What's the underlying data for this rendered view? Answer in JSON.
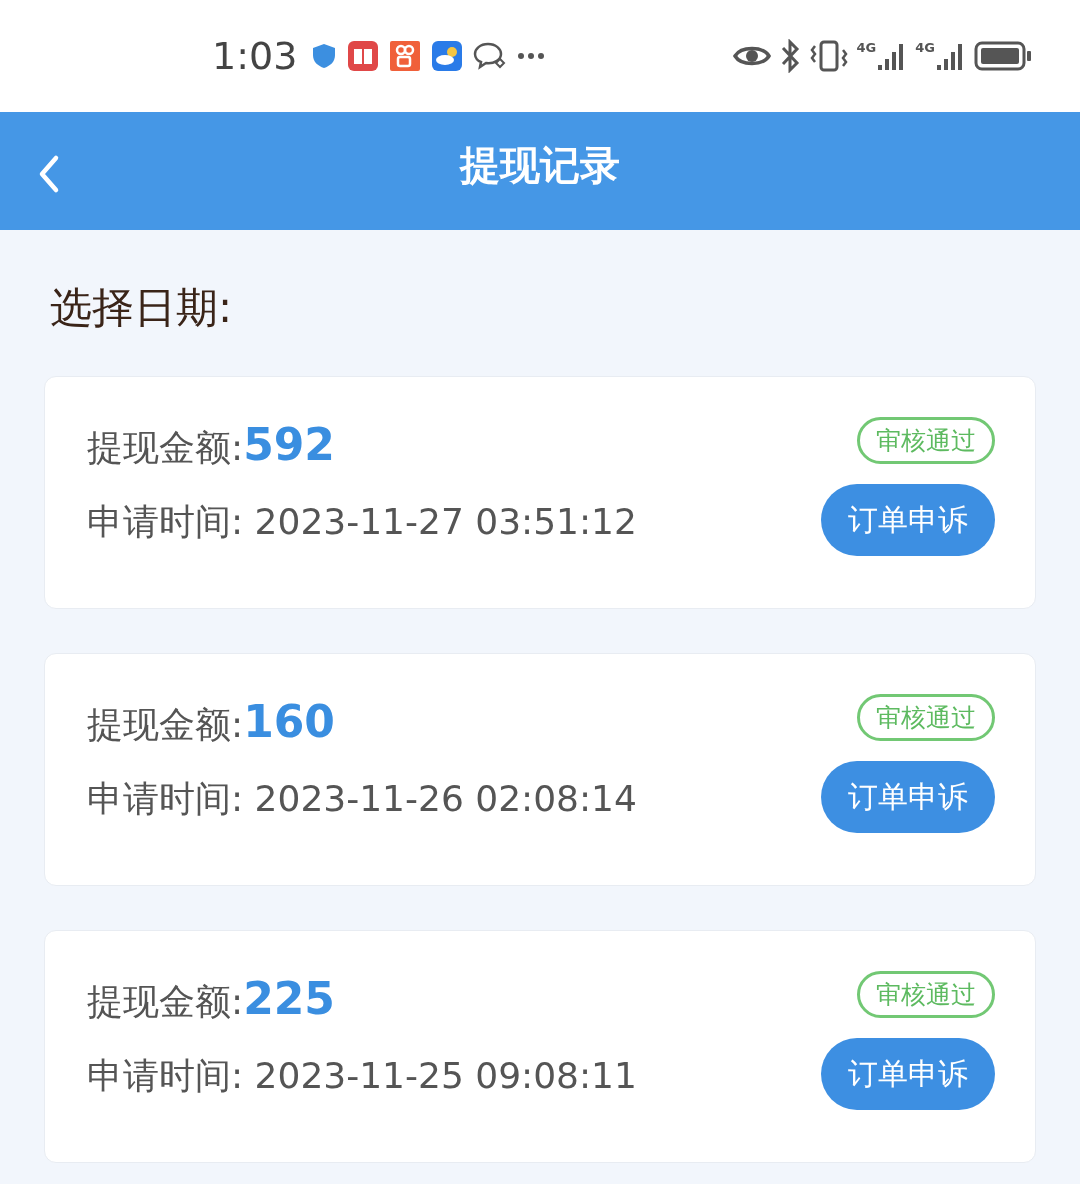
{
  "status_bar": {
    "time": "1:03",
    "network_labels": [
      "4G",
      "4G"
    ]
  },
  "header": {
    "title": "提现记录"
  },
  "date_filter": {
    "label": "选择日期:"
  },
  "records": [
    {
      "amount_label": "提现金额:",
      "amount": "592",
      "status": "审核通过",
      "time_label": "申请时间: 2023-11-27 03:51:12",
      "action": "订单申诉"
    },
    {
      "amount_label": "提现金额:",
      "amount": "160",
      "status": "审核通过",
      "time_label": "申请时间: 2023-11-26 02:08:14",
      "action": "订单申诉"
    },
    {
      "amount_label": "提现金额:",
      "amount": "225",
      "status": "审核通过",
      "time_label": "申请时间: 2023-11-25 09:08:11",
      "action": "订单申诉"
    }
  ]
}
